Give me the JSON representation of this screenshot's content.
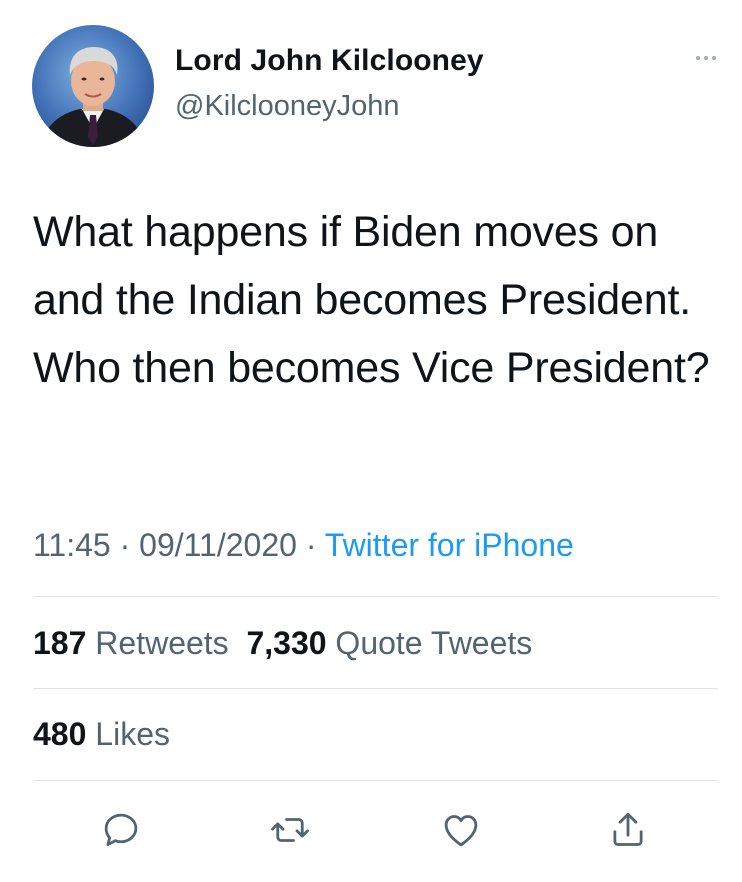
{
  "author": {
    "name": "Lord John Kilclooney",
    "handle": "@KilclooneyJohn"
  },
  "tweet": {
    "text": "What happens if Biden moves on and the Indian becomes President. Who then becomes Vice President?"
  },
  "meta": {
    "time": "11:45",
    "separator": " · ",
    "date": "09/11/2020",
    "source": "Twitter for iPhone"
  },
  "stats": {
    "retweets_count": "187",
    "retweets_label": "Retweets",
    "quotes_count": "7,330",
    "quotes_label": "Quote Tweets",
    "likes_count": "480",
    "likes_label": "Likes"
  },
  "icons": {
    "more": "more-horizontal-icon",
    "reply": "reply-icon",
    "retweet": "retweet-icon",
    "like": "heart-icon",
    "share": "share-icon"
  },
  "colors": {
    "link": "#1d9bf0",
    "secondary_text": "#536471",
    "primary_text": "#0f1419",
    "divider": "#dfe3e6"
  }
}
